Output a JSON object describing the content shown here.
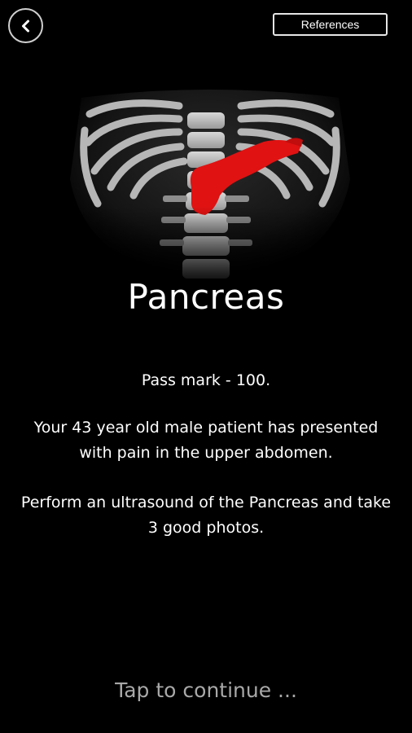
{
  "header": {
    "back_icon": "chevron-left-icon",
    "references_label": "References"
  },
  "hero": {
    "image": "torso-skeleton-with-highlighted-pancreas",
    "organ_color": "#e01212"
  },
  "title": "Pancreas",
  "content": {
    "pass_mark": "Pass mark - 100.",
    "scenario": "Your 43 year old male patient has presented with pain in the upper abdomen.",
    "instruction": "Perform an ultrasound of the Pancreas and take 3 good photos."
  },
  "footer": {
    "tap_label": "Tap to continue ..."
  }
}
